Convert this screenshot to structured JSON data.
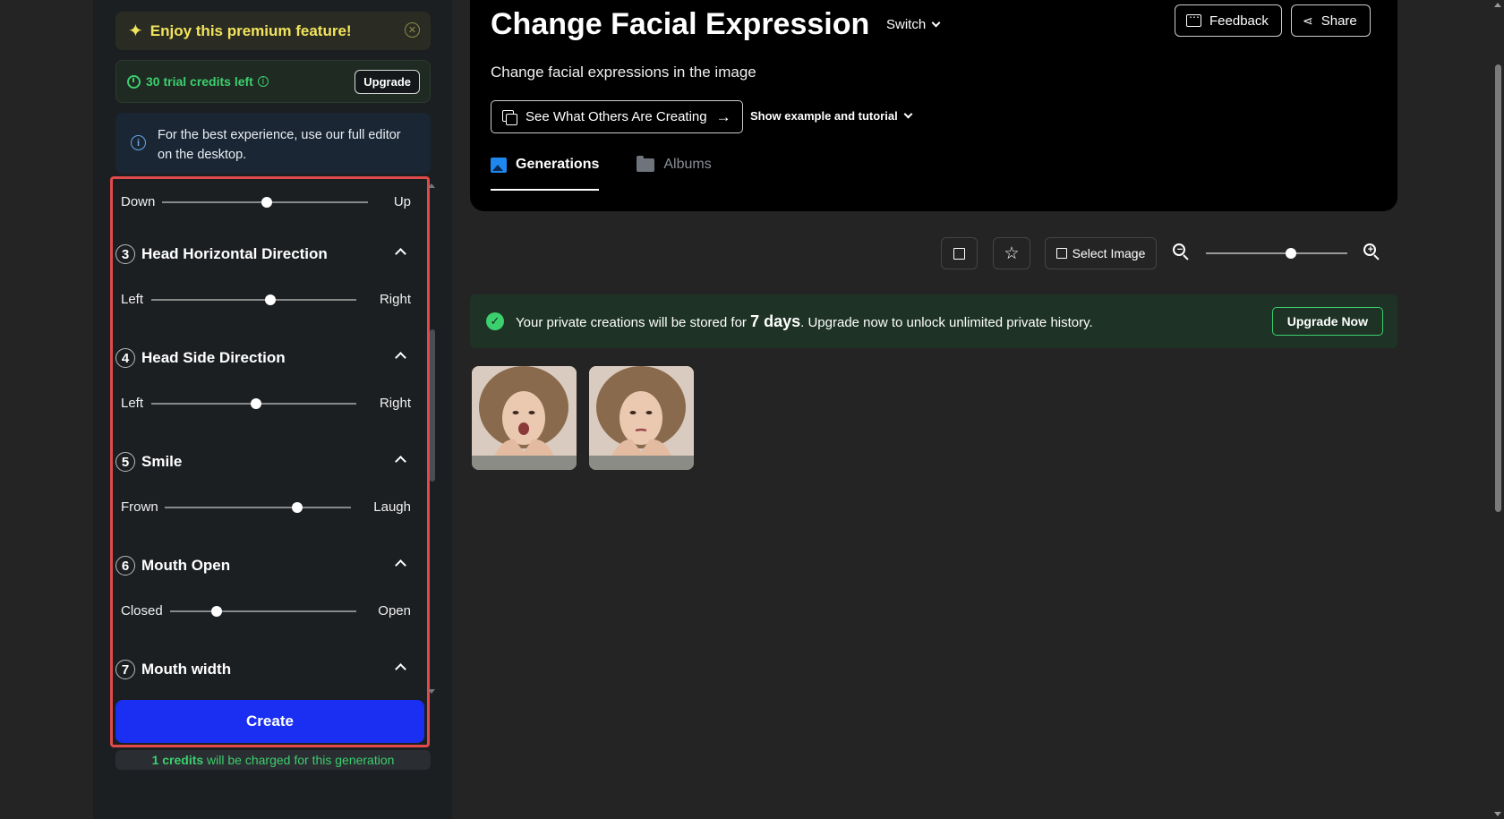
{
  "premium": {
    "text": "Enjoy this premium feature!"
  },
  "credits": {
    "text": "30 trial credits left",
    "upgrade_label": "Upgrade"
  },
  "notice": {
    "text": "For the best experience, use our full editor on the desktop."
  },
  "controls": {
    "top_slider": {
      "min_label": "Down",
      "max_label": "Up",
      "value": 0.51
    },
    "sections": [
      {
        "number": "3",
        "title": "Head Horizontal Direction",
        "min_label": "Left",
        "max_label": "Right",
        "value": 0.58
      },
      {
        "number": "4",
        "title": "Head Side Direction",
        "min_label": "Left",
        "max_label": "Right",
        "value": 0.51
      },
      {
        "number": "5",
        "title": "Smile",
        "min_label": "Frown",
        "max_label": "Laugh",
        "value": 0.71
      },
      {
        "number": "6",
        "title": "Mouth Open",
        "min_label": "Closed",
        "max_label": "Open",
        "value": 0.25
      },
      {
        "number": "7",
        "title": "Mouth width"
      }
    ],
    "create_label": "Create"
  },
  "charge_note": {
    "credits": "1 credits",
    "rest": " will be charged for this generation"
  },
  "header": {
    "title": "Change Facial Expression",
    "switch_label": "Switch",
    "subtitle": "Change facial expressions in the image",
    "see_others_label": "See What Others Are Creating",
    "tutorial_label": "Show example and tutorial",
    "feedback_label": "Feedback",
    "share_label": "Share",
    "tabs": [
      {
        "label": "Generations",
        "active": true
      },
      {
        "label": "Albums",
        "active": false
      }
    ]
  },
  "toolbar": {
    "select_image_label": "Select Image",
    "zoom": 0.6
  },
  "banner": {
    "text_before": "Your private creations will be stored for ",
    "days": "7 days",
    "text_after": ". Upgrade now to unlock unlimited private history.",
    "button_label": "Upgrade Now"
  },
  "gallery": {
    "count": 2
  },
  "colors": {
    "accent_blue": "#1a2ff2",
    "success_green": "#3ccf6e",
    "premium_yellow": "#f2e45c",
    "highlight_red": "#e04a4a"
  }
}
